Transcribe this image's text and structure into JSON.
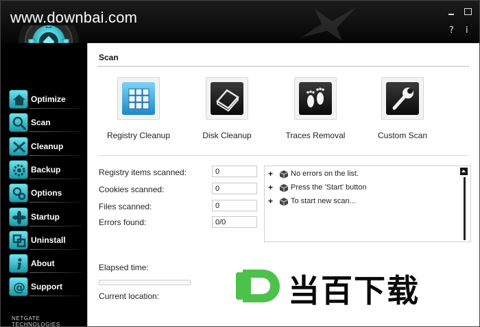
{
  "watermark": {
    "site": "www.downbai.com",
    "chinese": "当百下载",
    "logo_letter": "D"
  },
  "window_controls": {
    "help": "?",
    "info": "i"
  },
  "sidebar": {
    "items": [
      {
        "label": "Optimize",
        "icon": "house-icon"
      },
      {
        "label": "Scan",
        "icon": "magnifier-icon"
      },
      {
        "label": "Cleanup",
        "icon": "broom-x-icon"
      },
      {
        "label": "Backup",
        "icon": "backup-gear-icon"
      },
      {
        "label": "Options",
        "icon": "gears-icon"
      },
      {
        "label": "Startup",
        "icon": "fan-icon"
      },
      {
        "label": "Uninstall",
        "icon": "uninstall-icon"
      },
      {
        "label": "About",
        "icon": "info-icon"
      },
      {
        "label": "Support",
        "icon": "at-icon"
      }
    ],
    "brand": "NETGATE TECHNOLOGIES"
  },
  "main": {
    "title": "Scan",
    "tiles": [
      {
        "label": "Registry Cleanup",
        "icon": "registry-cubes-icon"
      },
      {
        "label": "Disk Cleanup",
        "icon": "disk-drive-icon"
      },
      {
        "label": "Traces Removal",
        "icon": "footprints-icon"
      },
      {
        "label": "Custom Scan",
        "icon": "wrench-icon"
      }
    ],
    "stats": [
      {
        "label": "Registry items scanned:",
        "value": "0"
      },
      {
        "label": "Cookies scanned:",
        "value": "0"
      },
      {
        "label": "Files scanned:",
        "value": "0"
      },
      {
        "label": "Errors found:",
        "value": "0/0"
      }
    ],
    "log": [
      "No errors on the list.",
      "Press the 'Start' button",
      "To start new scan..."
    ],
    "elapsed_label": "Elapsed time:",
    "current_label": "Current location:",
    "progress": 0
  },
  "colors": {
    "accent": "#36c6d4",
    "sidebar_bg": "#000000",
    "panel_bg": "#ffffff",
    "watermark_green": "#4cc24a"
  }
}
